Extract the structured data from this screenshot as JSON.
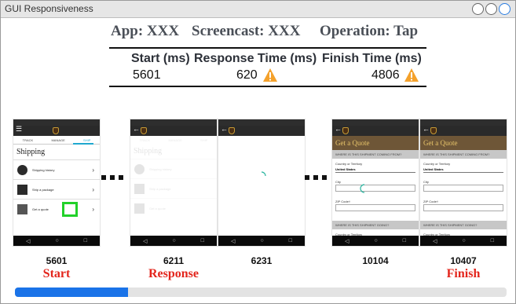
{
  "window": {
    "title": "GUI Responsiveness"
  },
  "header": {
    "app": "App: XXX",
    "screencast": "Screencast: XXX",
    "operation": "Operation: Tap"
  },
  "metrics": {
    "start_label": "Start (ms)",
    "start_value": "5601",
    "response_label": "Response Time (ms)",
    "response_value": "620",
    "finish_label": "Finish Time (ms)",
    "finish_value": "4806",
    "warning_icon": "warning-icon",
    "warning_color": "#f4a12b"
  },
  "frames": [
    {
      "time": "5601",
      "label": "Start"
    },
    {
      "time": "6211",
      "label": "Response"
    },
    {
      "time": "6231",
      "label": ""
    },
    {
      "time": "10104",
      "label": ""
    },
    {
      "time": "10407",
      "label": "Finish"
    }
  ],
  "app_screen": {
    "tabs": [
      "TRACK",
      "MANAGE",
      "SHIP"
    ],
    "title": "Shipping",
    "items": [
      "Shipping history",
      "Ship a package",
      "Get a quote"
    ],
    "quote_title": "Get a Quote",
    "origin_header": "WHERE IS THIS SHIPMENT COMING FROM?",
    "country_label": "Country or Territory",
    "country_value": "United States",
    "city_label": "City",
    "zip_label": "ZIP Code†",
    "dest_header": "WHERE IS THIS SHIPMENT GOING?"
  },
  "progress": {
    "fraction": 0.23
  },
  "colors": {
    "accent_red": "#e3241b",
    "progress_blue": "#1a73e8",
    "tap_green": "#22d12a"
  }
}
